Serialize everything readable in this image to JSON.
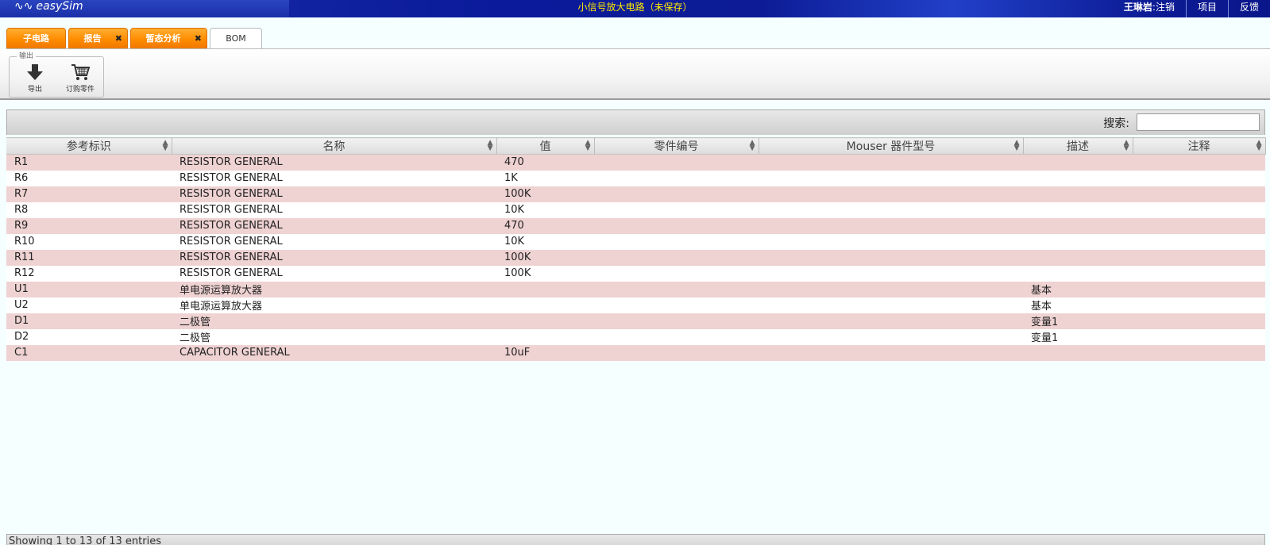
{
  "app": {
    "logo": "easySim",
    "doc_title": "小信号放大电路（未保存）"
  },
  "top_right": {
    "user": "王琳岩",
    "logout": ":注销",
    "project": "项目",
    "feedback": "反馈"
  },
  "tabs": [
    {
      "label": "子电路",
      "closable": false
    },
    {
      "label": "报告",
      "closable": true
    },
    {
      "label": "暂态分析",
      "closable": true
    },
    {
      "label": "BOM",
      "closable": false,
      "active": true
    }
  ],
  "toolbar": {
    "group_label": "输出",
    "export_label": "导出",
    "order_label": "订购零件"
  },
  "search": {
    "label": "搜索:",
    "value": ""
  },
  "table": {
    "headers": [
      "参考标识",
      "名称",
      "值",
      "零件编号",
      "Mouser 器件型号",
      "描述",
      "注释"
    ],
    "rows": [
      [
        "R1",
        "RESISTOR GENERAL",
        "470",
        "",
        "",
        "",
        ""
      ],
      [
        "R6",
        "RESISTOR GENERAL",
        "1K",
        "",
        "",
        "",
        ""
      ],
      [
        "R7",
        "RESISTOR GENERAL",
        "100K",
        "",
        "",
        "",
        ""
      ],
      [
        "R8",
        "RESISTOR GENERAL",
        "10K",
        "",
        "",
        "",
        ""
      ],
      [
        "R9",
        "RESISTOR GENERAL",
        "470",
        "",
        "",
        "",
        ""
      ],
      [
        "R10",
        "RESISTOR GENERAL",
        "10K",
        "",
        "",
        "",
        ""
      ],
      [
        "R11",
        "RESISTOR GENERAL",
        "100K",
        "",
        "",
        "",
        ""
      ],
      [
        "R12",
        "RESISTOR GENERAL",
        "100K",
        "",
        "",
        "",
        ""
      ],
      [
        "U1",
        "单电源运算放大器",
        "",
        "",
        "",
        "基本",
        ""
      ],
      [
        "U2",
        "单电源运算放大器",
        "",
        "",
        "",
        "基本",
        ""
      ],
      [
        "D1",
        "二极管",
        "",
        "",
        "",
        "变量1",
        ""
      ],
      [
        "D2",
        "二极管",
        "",
        "",
        "",
        "变量1",
        ""
      ],
      [
        "C1",
        "CAPACITOR GENERAL",
        "10uF",
        "",
        "",
        "",
        ""
      ]
    ]
  },
  "footer": {
    "info": "Showing 1 to 13 of 13 entries"
  },
  "colors": {
    "odd_row": "#efd2d2",
    "tab_orange": "#ff8c00",
    "title_yellow": "#ffea00"
  }
}
